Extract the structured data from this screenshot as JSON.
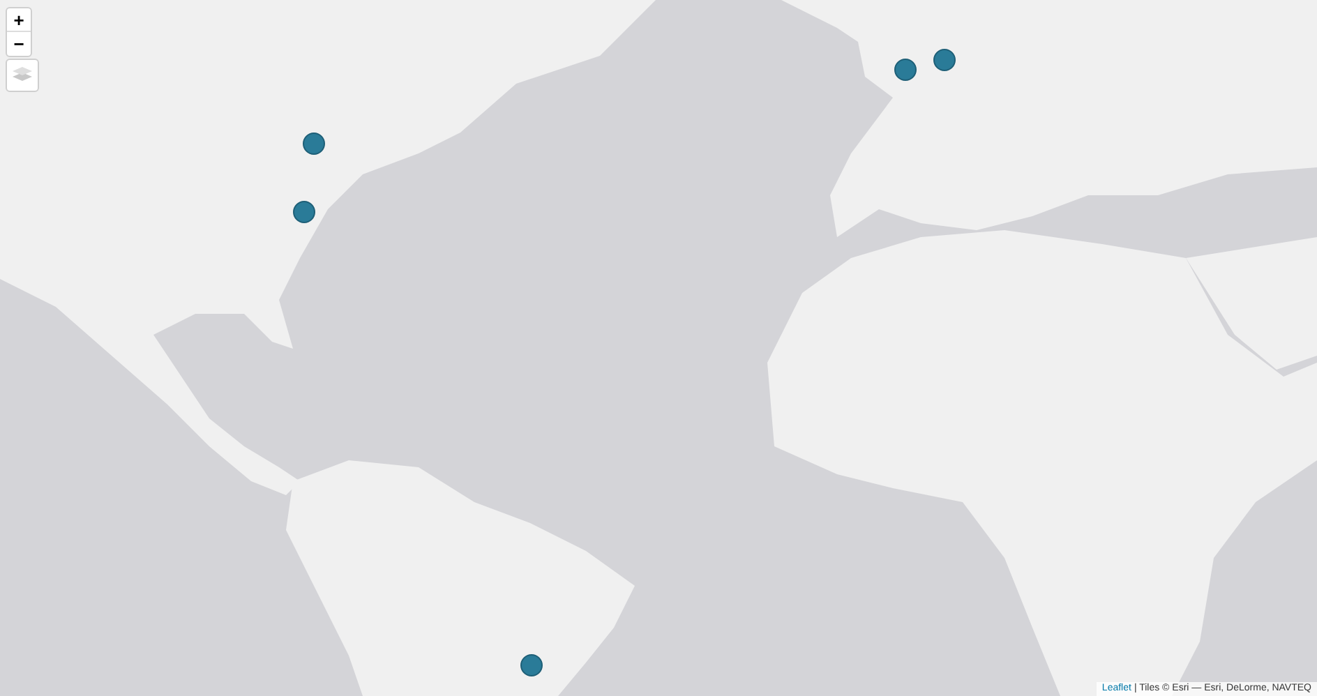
{
  "zoom_control": {
    "zoom_in": "+",
    "zoom_out": "−"
  },
  "attribution": {
    "link": "Leaflet",
    "text": "| Tiles © Esri — Esri, DeLorme, NAVTEQ"
  }
}
